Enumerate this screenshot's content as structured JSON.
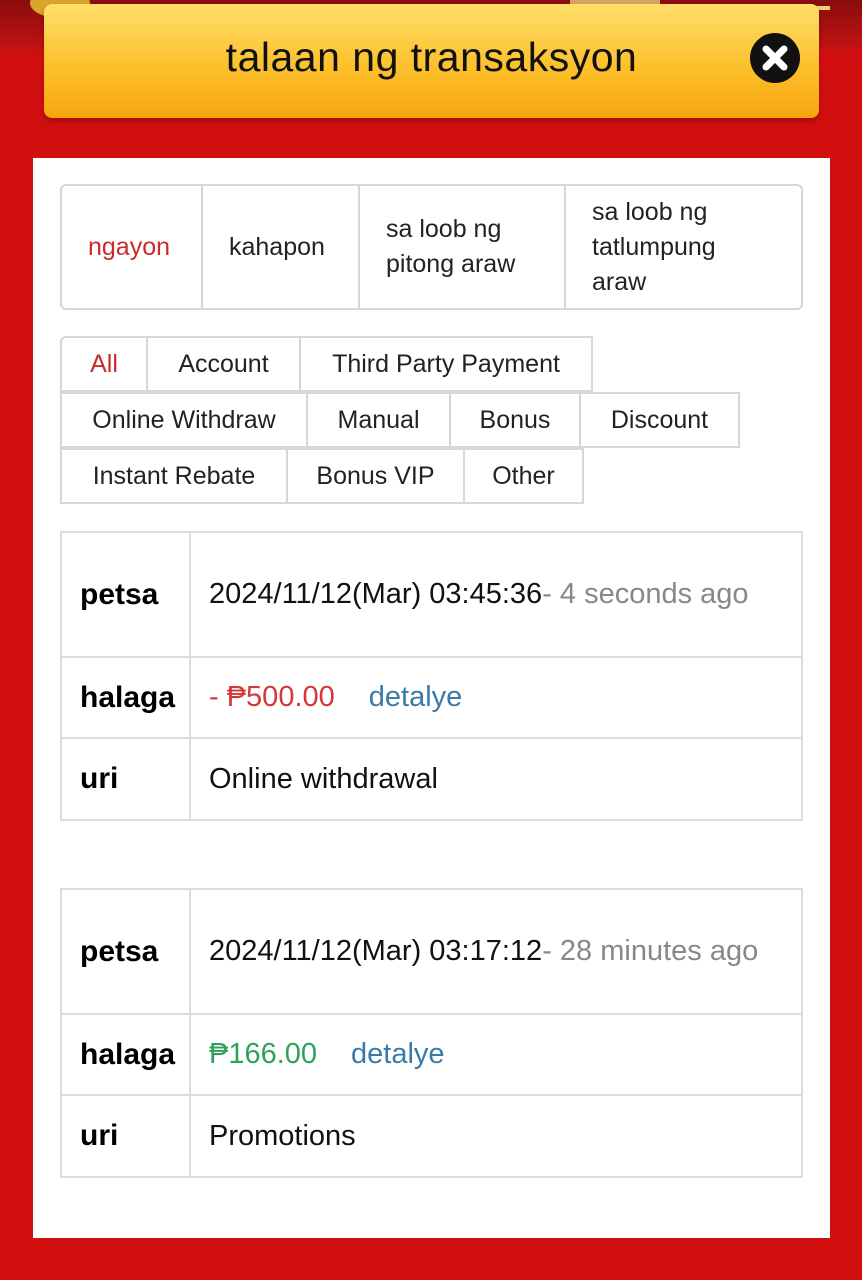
{
  "dialog": {
    "title": "talaan ng transaksyon"
  },
  "date_ranges": [
    {
      "label": "ngayon",
      "active": true
    },
    {
      "label": "kahapon",
      "active": false
    },
    {
      "label": "sa loob ng pitong araw",
      "active": false
    },
    {
      "label": "sa loob ng tatlumpung araw",
      "active": false
    }
  ],
  "categories": [
    {
      "label": "All",
      "active": true
    },
    {
      "label": "Account"
    },
    {
      "label": "Third Party Payment"
    },
    {
      "label": "Online Withdraw"
    },
    {
      "label": "Manual"
    },
    {
      "label": "Bonus"
    },
    {
      "label": "Discount"
    },
    {
      "label": "Instant Rebate"
    },
    {
      "label": "Bonus VIP"
    },
    {
      "label": "Other"
    }
  ],
  "labels": {
    "date": "petsa",
    "amount": "halaga",
    "type": "uri",
    "detail": "detalye"
  },
  "transactions": [
    {
      "datetime": "2024/11/12(Mar) 03:45:36",
      "ago": "- 4 seconds ago",
      "amount": "- ₱500.00",
      "type": "Online withdrawal"
    },
    {
      "datetime": "2024/11/12(Mar) 03:17:12",
      "ago": "- 28 minutes ago",
      "amount": "₱166.00",
      "type": "Promotions"
    }
  ],
  "colors": {
    "background_red": "#d20f0f",
    "header_gold": "#fcc12c",
    "active_red": "#c92a2a",
    "negative_amount": "#d33838",
    "positive_amount": "#2ea25a",
    "link_blue": "#3a79a8"
  }
}
